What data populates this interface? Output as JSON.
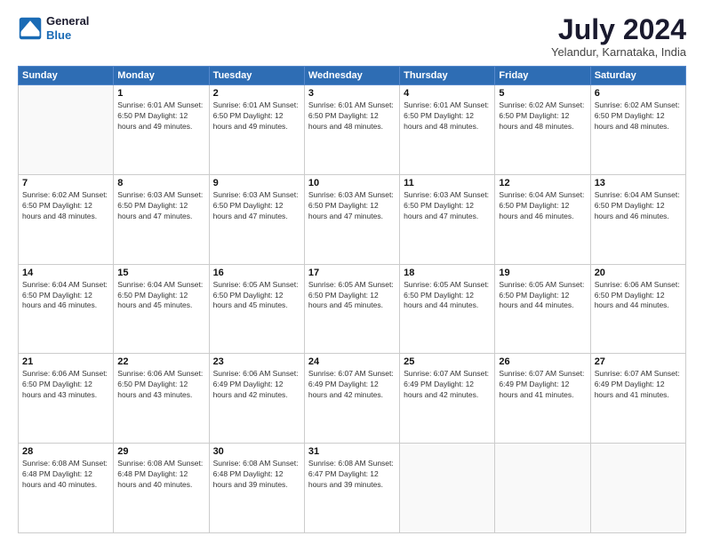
{
  "logo": {
    "line1": "General",
    "line2": "Blue"
  },
  "title": "July 2024",
  "subtitle": "Yelandur, Karnataka, India",
  "headers": [
    "Sunday",
    "Monday",
    "Tuesday",
    "Wednesday",
    "Thursday",
    "Friday",
    "Saturday"
  ],
  "weeks": [
    [
      {
        "day": "",
        "info": ""
      },
      {
        "day": "1",
        "info": "Sunrise: 6:01 AM\nSunset: 6:50 PM\nDaylight: 12 hours\nand 49 minutes."
      },
      {
        "day": "2",
        "info": "Sunrise: 6:01 AM\nSunset: 6:50 PM\nDaylight: 12 hours\nand 49 minutes."
      },
      {
        "day": "3",
        "info": "Sunrise: 6:01 AM\nSunset: 6:50 PM\nDaylight: 12 hours\nand 48 minutes."
      },
      {
        "day": "4",
        "info": "Sunrise: 6:01 AM\nSunset: 6:50 PM\nDaylight: 12 hours\nand 48 minutes."
      },
      {
        "day": "5",
        "info": "Sunrise: 6:02 AM\nSunset: 6:50 PM\nDaylight: 12 hours\nand 48 minutes."
      },
      {
        "day": "6",
        "info": "Sunrise: 6:02 AM\nSunset: 6:50 PM\nDaylight: 12 hours\nand 48 minutes."
      }
    ],
    [
      {
        "day": "7",
        "info": "Sunrise: 6:02 AM\nSunset: 6:50 PM\nDaylight: 12 hours\nand 48 minutes."
      },
      {
        "day": "8",
        "info": "Sunrise: 6:03 AM\nSunset: 6:50 PM\nDaylight: 12 hours\nand 47 minutes."
      },
      {
        "day": "9",
        "info": "Sunrise: 6:03 AM\nSunset: 6:50 PM\nDaylight: 12 hours\nand 47 minutes."
      },
      {
        "day": "10",
        "info": "Sunrise: 6:03 AM\nSunset: 6:50 PM\nDaylight: 12 hours\nand 47 minutes."
      },
      {
        "day": "11",
        "info": "Sunrise: 6:03 AM\nSunset: 6:50 PM\nDaylight: 12 hours\nand 47 minutes."
      },
      {
        "day": "12",
        "info": "Sunrise: 6:04 AM\nSunset: 6:50 PM\nDaylight: 12 hours\nand 46 minutes."
      },
      {
        "day": "13",
        "info": "Sunrise: 6:04 AM\nSunset: 6:50 PM\nDaylight: 12 hours\nand 46 minutes."
      }
    ],
    [
      {
        "day": "14",
        "info": "Sunrise: 6:04 AM\nSunset: 6:50 PM\nDaylight: 12 hours\nand 46 minutes."
      },
      {
        "day": "15",
        "info": "Sunrise: 6:04 AM\nSunset: 6:50 PM\nDaylight: 12 hours\nand 45 minutes."
      },
      {
        "day": "16",
        "info": "Sunrise: 6:05 AM\nSunset: 6:50 PM\nDaylight: 12 hours\nand 45 minutes."
      },
      {
        "day": "17",
        "info": "Sunrise: 6:05 AM\nSunset: 6:50 PM\nDaylight: 12 hours\nand 45 minutes."
      },
      {
        "day": "18",
        "info": "Sunrise: 6:05 AM\nSunset: 6:50 PM\nDaylight: 12 hours\nand 44 minutes."
      },
      {
        "day": "19",
        "info": "Sunrise: 6:05 AM\nSunset: 6:50 PM\nDaylight: 12 hours\nand 44 minutes."
      },
      {
        "day": "20",
        "info": "Sunrise: 6:06 AM\nSunset: 6:50 PM\nDaylight: 12 hours\nand 44 minutes."
      }
    ],
    [
      {
        "day": "21",
        "info": "Sunrise: 6:06 AM\nSunset: 6:50 PM\nDaylight: 12 hours\nand 43 minutes."
      },
      {
        "day": "22",
        "info": "Sunrise: 6:06 AM\nSunset: 6:50 PM\nDaylight: 12 hours\nand 43 minutes."
      },
      {
        "day": "23",
        "info": "Sunrise: 6:06 AM\nSunset: 6:49 PM\nDaylight: 12 hours\nand 42 minutes."
      },
      {
        "day": "24",
        "info": "Sunrise: 6:07 AM\nSunset: 6:49 PM\nDaylight: 12 hours\nand 42 minutes."
      },
      {
        "day": "25",
        "info": "Sunrise: 6:07 AM\nSunset: 6:49 PM\nDaylight: 12 hours\nand 42 minutes."
      },
      {
        "day": "26",
        "info": "Sunrise: 6:07 AM\nSunset: 6:49 PM\nDaylight: 12 hours\nand 41 minutes."
      },
      {
        "day": "27",
        "info": "Sunrise: 6:07 AM\nSunset: 6:49 PM\nDaylight: 12 hours\nand 41 minutes."
      }
    ],
    [
      {
        "day": "28",
        "info": "Sunrise: 6:08 AM\nSunset: 6:48 PM\nDaylight: 12 hours\nand 40 minutes."
      },
      {
        "day": "29",
        "info": "Sunrise: 6:08 AM\nSunset: 6:48 PM\nDaylight: 12 hours\nand 40 minutes."
      },
      {
        "day": "30",
        "info": "Sunrise: 6:08 AM\nSunset: 6:48 PM\nDaylight: 12 hours\nand 39 minutes."
      },
      {
        "day": "31",
        "info": "Sunrise: 6:08 AM\nSunset: 6:47 PM\nDaylight: 12 hours\nand 39 minutes."
      },
      {
        "day": "",
        "info": ""
      },
      {
        "day": "",
        "info": ""
      },
      {
        "day": "",
        "info": ""
      }
    ]
  ]
}
